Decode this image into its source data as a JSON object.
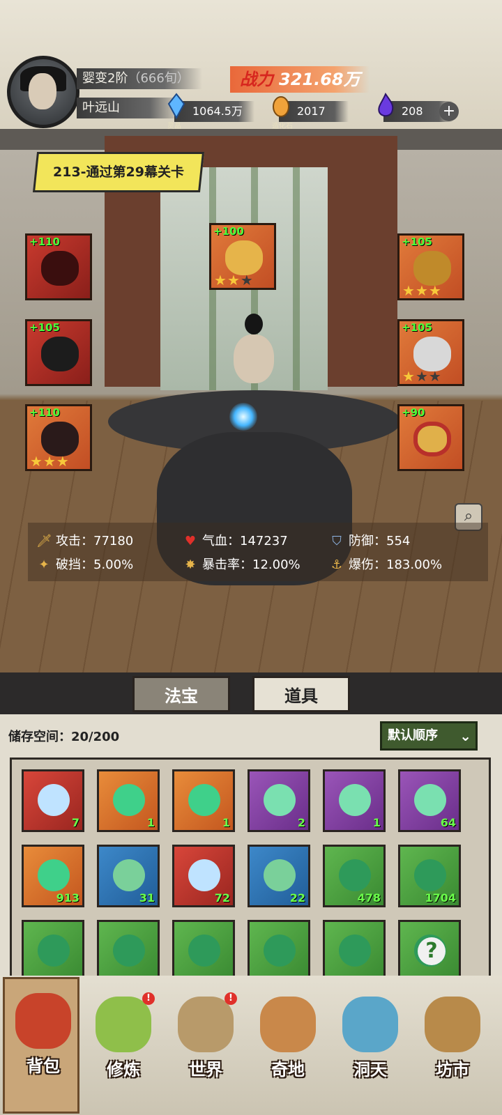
{
  "player": {
    "realm": "婴变2阶",
    "realm_sub": "（666旬）",
    "name": "叶远山"
  },
  "power": {
    "label": "战力",
    "value": "321.68万"
  },
  "resources": [
    {
      "icon": "spirit-crystal-icon",
      "label": "灵晶",
      "value": "1064.5万"
    },
    {
      "icon": "creation-stone-icon",
      "label": "造化石",
      "value": "2017"
    },
    {
      "icon": "spirit-flame-icon",
      "label": "",
      "value": "208"
    }
  ],
  "quest_banner": "213-通过第29幕关卡",
  "equipment": [
    {
      "slot": "weapon",
      "level": "+110",
      "stars": 0
    },
    {
      "slot": "talisman",
      "level": "+100",
      "stars": 2
    },
    {
      "slot": "crown",
      "level": "+105",
      "stars": 3
    },
    {
      "slot": "robe",
      "level": "+105",
      "stars": 0
    },
    {
      "slot": "necklace",
      "level": "+105",
      "stars": 1
    },
    {
      "slot": "boots",
      "level": "+110",
      "stars": 3
    },
    {
      "slot": "ring",
      "level": "+90",
      "stars": 0
    }
  ],
  "stats": [
    {
      "icon": "sword-icon",
      "label": "攻击：",
      "value": "77180"
    },
    {
      "icon": "heart-icon",
      "label": "气血：",
      "value": "147237"
    },
    {
      "icon": "shield-icon",
      "label": "防御：",
      "value": "554"
    },
    {
      "icon": "break-icon",
      "label": "破挡：",
      "value": "5.00%"
    },
    {
      "icon": "crit-icon",
      "label": "暴击率：",
      "value": "12.00%"
    },
    {
      "icon": "crit-damage-icon",
      "label": "爆伤：",
      "value": "183.00%"
    }
  ],
  "tabs": [
    "法宝",
    "道具"
  ],
  "active_tab": "道具",
  "bag": {
    "storage_label": "储存空间：",
    "storage_value": "20/200",
    "sort_label": "默认顺序",
    "items": [
      {
        "color": "red",
        "count": "7"
      },
      {
        "color": "orange",
        "count": "1"
      },
      {
        "color": "orange",
        "count": "1"
      },
      {
        "color": "purple",
        "count": "2"
      },
      {
        "color": "purple",
        "count": "1"
      },
      {
        "color": "purple",
        "count": "64"
      },
      {
        "color": "orange",
        "count": "913"
      },
      {
        "color": "blue",
        "count": "31"
      },
      {
        "color": "red",
        "count": "72"
      },
      {
        "color": "blue",
        "count": "22"
      },
      {
        "color": "green",
        "count": "478"
      },
      {
        "color": "green",
        "count": "1704"
      },
      {
        "color": "green",
        "count": ""
      },
      {
        "color": "green",
        "count": ""
      },
      {
        "color": "green",
        "count": ""
      },
      {
        "color": "green",
        "count": ""
      },
      {
        "color": "green",
        "count": ""
      },
      {
        "color": "green",
        "count": "",
        "mystery": "?"
      }
    ]
  },
  "nav": [
    {
      "label": "背包",
      "icon": "bag-icon",
      "badge": ""
    },
    {
      "label": "修炼",
      "icon": "cultivate-icon",
      "badge": "!"
    },
    {
      "label": "世界",
      "icon": "world-icon",
      "badge": "!"
    },
    {
      "label": "奇地",
      "icon": "wonderland-icon",
      "badge": ""
    },
    {
      "label": "洞天",
      "icon": "cave-icon",
      "badge": ""
    },
    {
      "label": "坊市",
      "icon": "market-icon",
      "badge": ""
    }
  ],
  "colors": {
    "power_bg": "#e9683a",
    "stat_green": "#4cff3a",
    "banner_yellow": "#f2e55a",
    "sort_green": "#3f5a2e"
  }
}
